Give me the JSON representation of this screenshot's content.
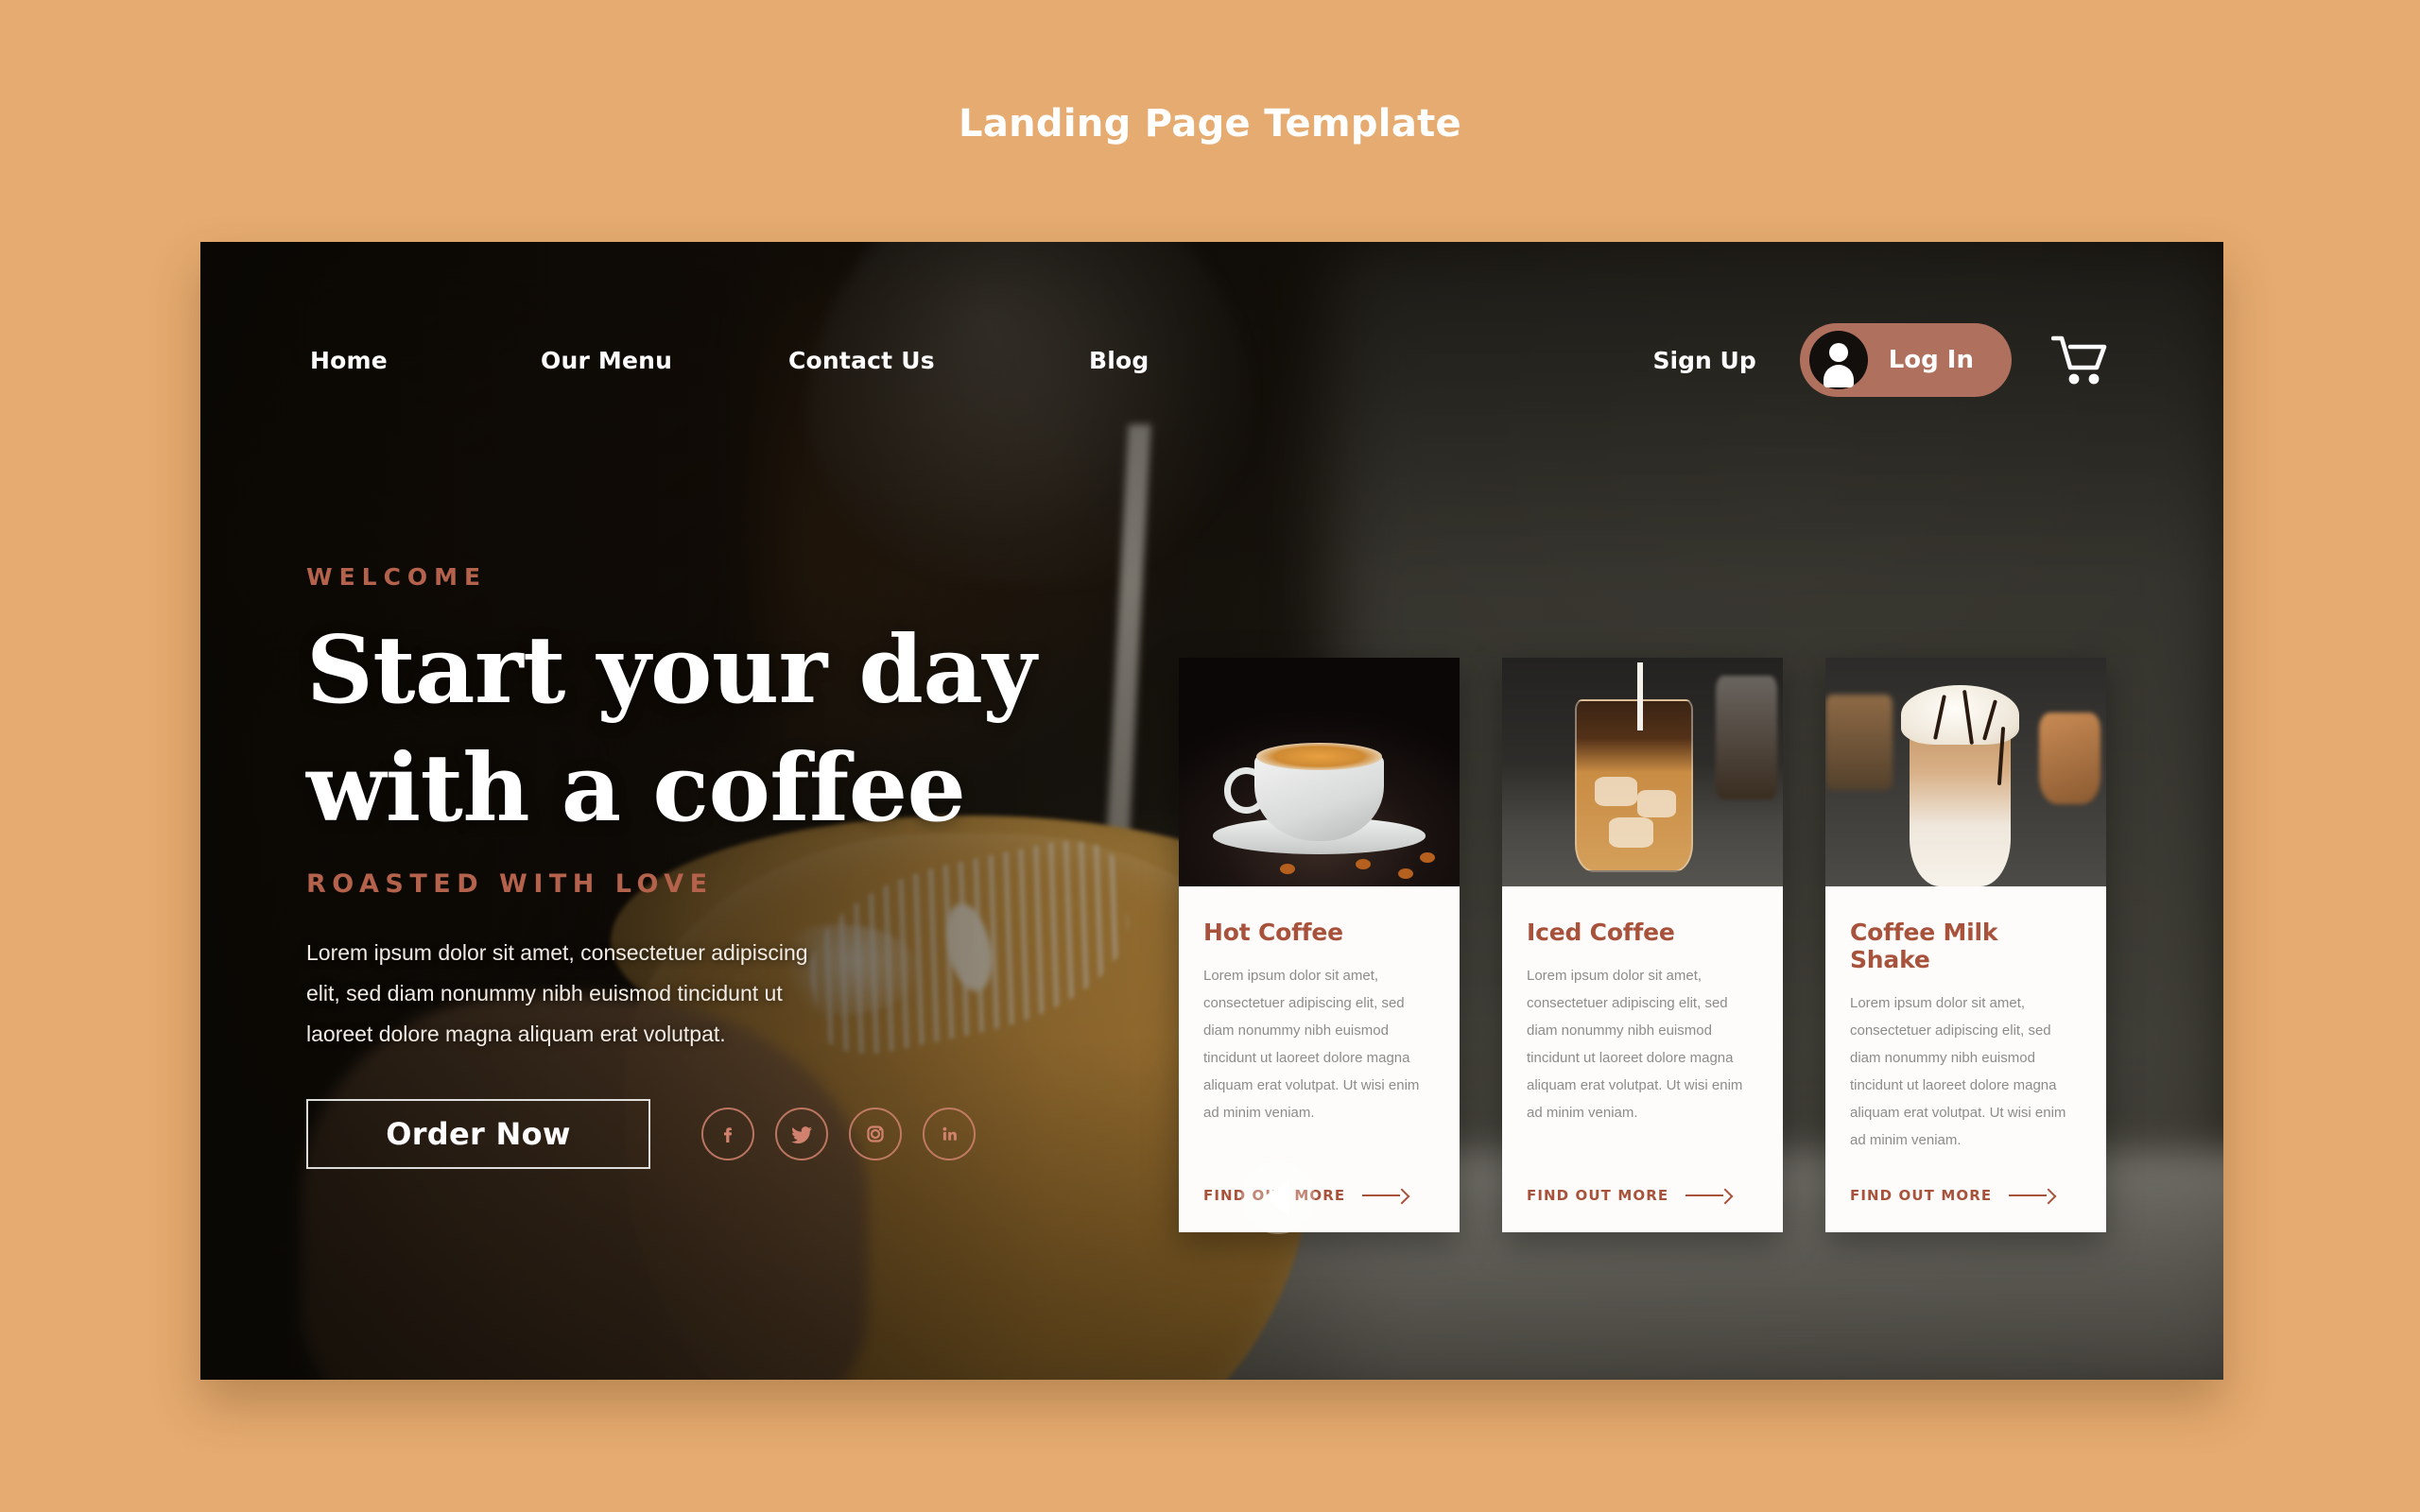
{
  "page": {
    "title": "Landing Page Template",
    "background_color": "#e5ab70",
    "accent_color": "#a8523c",
    "login_pill_color": "#b0705e"
  },
  "nav": {
    "links": [
      {
        "label": "Home"
      },
      {
        "label": "Our Menu"
      },
      {
        "label": "Contact Us"
      },
      {
        "label": "Blog"
      }
    ],
    "sign_up_label": "Sign Up",
    "log_in_label": "Log In",
    "avatar_icon": "user-avatar-icon",
    "cart_icon": "shopping-cart-icon"
  },
  "hero": {
    "eyebrow": "WELCOME",
    "headline_line1": "Start your day",
    "headline_line2": "with a coffee",
    "subline": "ROASTED WITH LOVE",
    "paragraph": "Lorem ipsum dolor sit amet, consectetuer adipiscing elit, sed diam nonummy nibh euismod tincidunt ut laoreet dolore magna aliquam erat volutpat.",
    "cta_label": "Order Now",
    "socials": [
      {
        "name": "facebook-icon"
      },
      {
        "name": "twitter-icon"
      },
      {
        "name": "instagram-icon"
      },
      {
        "name": "linkedin-icon"
      }
    ]
  },
  "carousel": {
    "prev_icon": "chevron-left-icon",
    "next_icon": "chevron-right-icon",
    "cards": [
      {
        "title": "Hot Coffee",
        "text": "Lorem ipsum dolor sit amet, consectetuer adipiscing elit, sed diam nonummy nibh euismod tincidunt ut laoreet dolore magna aliquam erat volutpat. Ut wisi enim ad minim veniam.",
        "link_label": "FIND OUT MORE",
        "image_alt": "white cup of hot coffee with coffee beans"
      },
      {
        "title": "Iced Coffee",
        "text": "Lorem ipsum dolor sit amet, consectetuer adipiscing elit, sed diam nonummy nibh euismod tincidunt ut laoreet dolore magna aliquam erat volutpat. Ut wisi enim ad minim veniam.",
        "link_label": "FIND OUT MORE",
        "image_alt": "glass of iced coffee with milk pouring in"
      },
      {
        "title": "Coffee Milk Shake",
        "text": "Lorem ipsum dolor sit amet, consectetuer adipiscing elit, sed diam nonummy nibh euismod tincidunt ut laoreet dolore magna aliquam erat volutpat. Ut wisi enim ad minim veniam.",
        "link_label": "FIND OUT MORE",
        "image_alt": "coffee milkshake with whipped cream and chocolate drizzle"
      }
    ]
  }
}
